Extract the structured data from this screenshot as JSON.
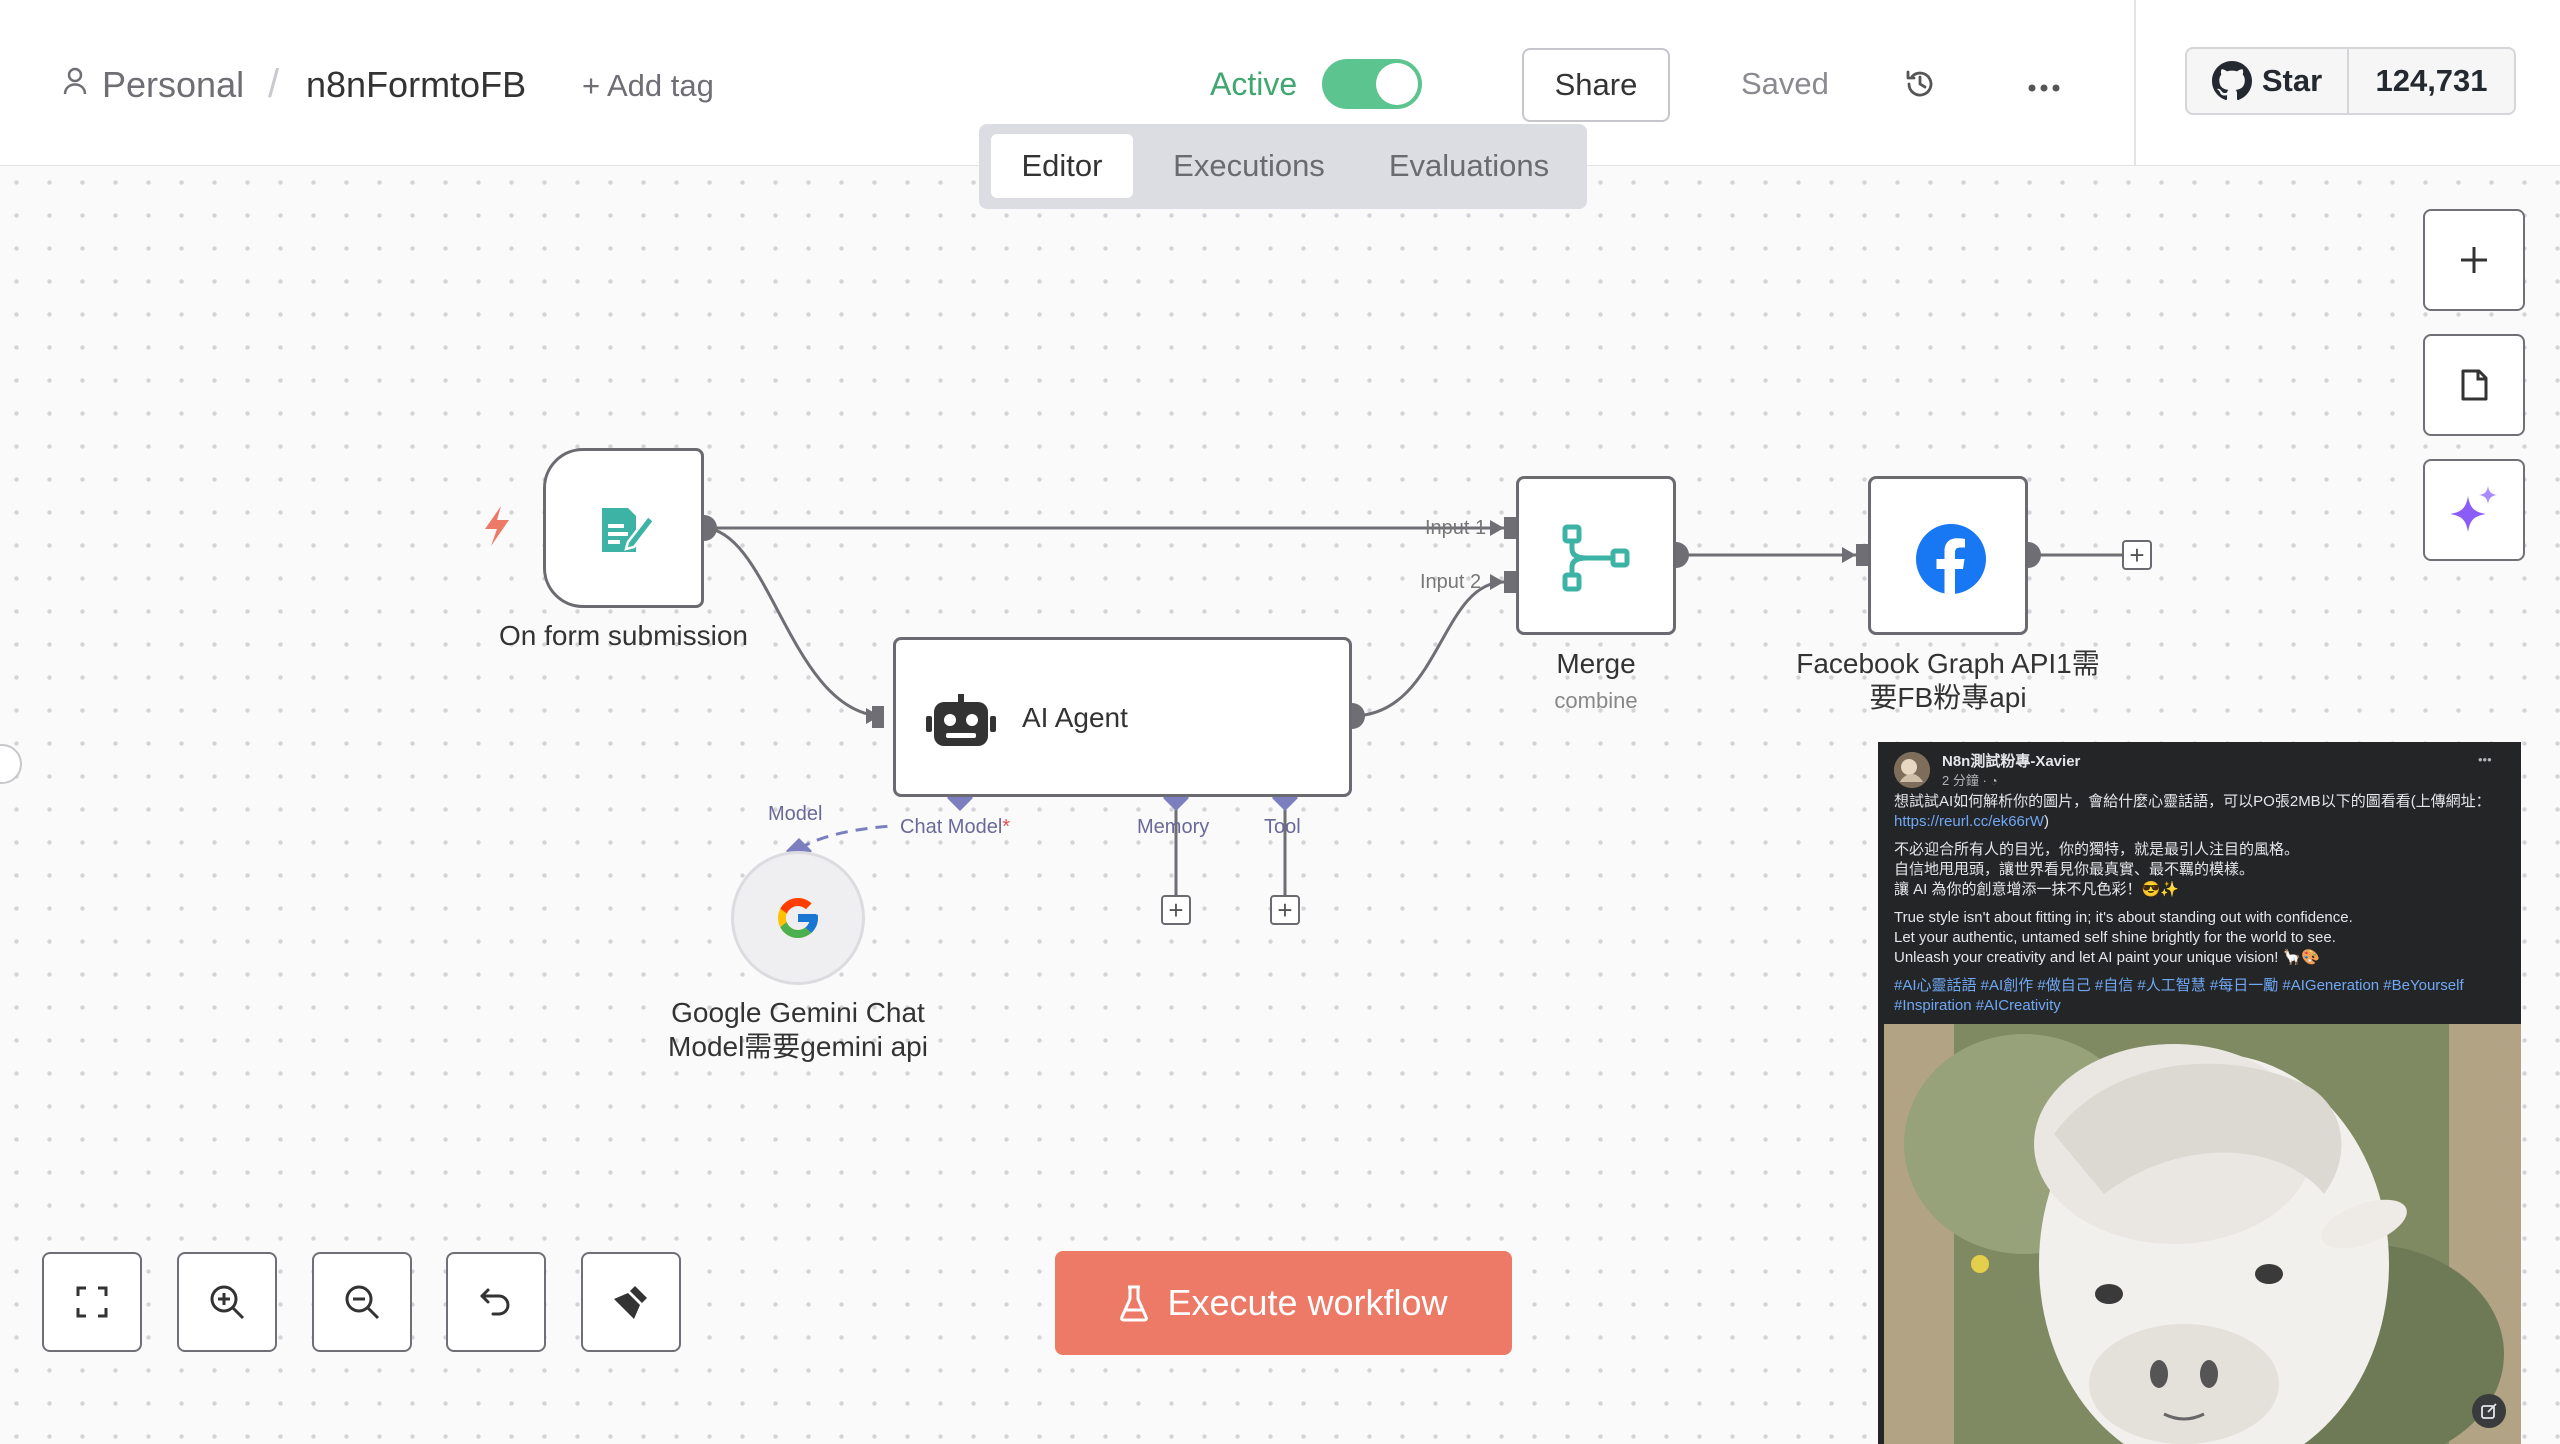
{
  "header": {
    "breadcrumb_project": "Personal",
    "breadcrumb_separator": "/",
    "workflow_name": "n8nFormtoFB",
    "add_tag": "+ Add tag",
    "active_label": "Active",
    "active_toggle": true,
    "share_label": "Share",
    "saved_label": "Saved",
    "github_star_label": "Star",
    "github_star_count": "124,731"
  },
  "tabs": [
    {
      "label": "Editor",
      "selected": true
    },
    {
      "label": "Executions",
      "selected": false
    },
    {
      "label": "Evaluations",
      "selected": false
    }
  ],
  "nodes": {
    "form": {
      "label": "On form submission"
    },
    "agent": {
      "label": "AI Agent",
      "ports": {
        "chat_model": "Chat Model",
        "required_mark": "*",
        "memory": "Memory",
        "tool": "Tool"
      }
    },
    "gemini": {
      "label_line1": "Google Gemini Chat",
      "label_line2": "Model需要gemini api",
      "port": "Model"
    },
    "merge": {
      "label": "Merge",
      "sublabel": "combine",
      "input1": "Input 1",
      "input2": "Input 2"
    },
    "facebook": {
      "label_line1": "Facebook Graph API1需",
      "label_line2": "要FB粉專api"
    }
  },
  "execute_button": "Execute workflow",
  "facebook_post": {
    "page_name": "N8n測試粉專-Xavier",
    "time": "2 分鐘 · ",
    "more": "•••",
    "para1_line1": "想試試AI如何解析你的圖片，會給什麼心靈話語，可以PO張2MB以下的圖看看(上傳網址：",
    "para1_link": "https://reurl.cc/ek66rW",
    "para1_end": ")",
    "para2": [
      "不必迎合所有人的目光，你的獨特，就是最引人注目的風格。",
      "自信地甩甩頭，讓世界看見你最真實、最不羈的模樣。",
      "讓 AI 為你的創意增添一抹不凡色彩！😎✨"
    ],
    "para3": [
      "True style isn't about fitting in; it's about standing out with confidence.",
      "Let your authentic, untamed self shine brightly for the world to see.",
      "Unleash your creativity and let AI paint your unique vision! 🦙🎨"
    ],
    "hashtags_line1": "#AI心靈話語 #AI創作 #做自己 #自信 #人工智慧 #每日一勵 #AIGeneration #BeYourself",
    "hashtags_line2": "#Inspiration #AICreativity"
  },
  "colors": {
    "accent_green": "#56c18c",
    "execute_red": "#ec7a66",
    "node_teal": "#3db3a6",
    "facebook_blue": "#1877f2",
    "port_purple": "#7b7fc0"
  }
}
